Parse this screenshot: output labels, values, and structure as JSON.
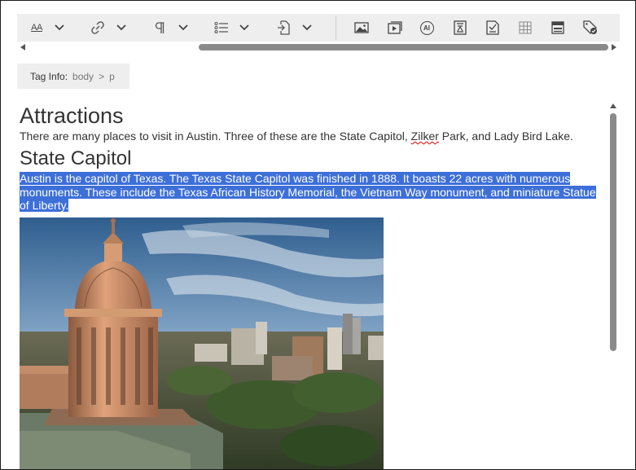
{
  "toolbar": {
    "items": [
      {
        "icon": "font-size-icon",
        "label": "AA",
        "dropdown": true
      },
      {
        "icon": "link-icon",
        "dropdown": true
      },
      {
        "icon": "paragraph-icon",
        "dropdown": true
      },
      {
        "icon": "list-icon",
        "dropdown": true
      },
      {
        "icon": "insert-file-icon",
        "dropdown": true
      },
      {
        "icon": "image-icon"
      },
      {
        "icon": "video-icon"
      },
      {
        "icon": "ai-icon",
        "label": "AI"
      },
      {
        "icon": "special-character-icon"
      },
      {
        "icon": "spell-check-icon"
      },
      {
        "icon": "table-icon"
      },
      {
        "icon": "template-icon"
      },
      {
        "icon": "tag-icon"
      }
    ]
  },
  "tag_info": {
    "label": "Tag Info:",
    "path": [
      "body",
      "p"
    ],
    "separator": ">"
  },
  "document": {
    "heading1": "Attractions",
    "intro_before": "There are many places to visit in Austin. Three of these are the State Capitol, ",
    "intro_misspelled": "Zilker",
    "intro_after": " Park, and Lady Bird Lake.",
    "heading2": "State Capitol",
    "selected_paragraph_line1": "Austin is the capitol of Texas. The Texas State Capitol was finished in 1888. It boasts 22 acres with numerous ",
    "selected_paragraph_line2": "monuments. These include the Texas African History Memorial, the Vietnam Way monument, and miniature Statue ",
    "selected_paragraph_line3": "of Liberty."
  },
  "colors": {
    "selection": "#3d6fd9",
    "toolbar_bg": "#eeeeee",
    "spell_error": "#dd0000"
  }
}
